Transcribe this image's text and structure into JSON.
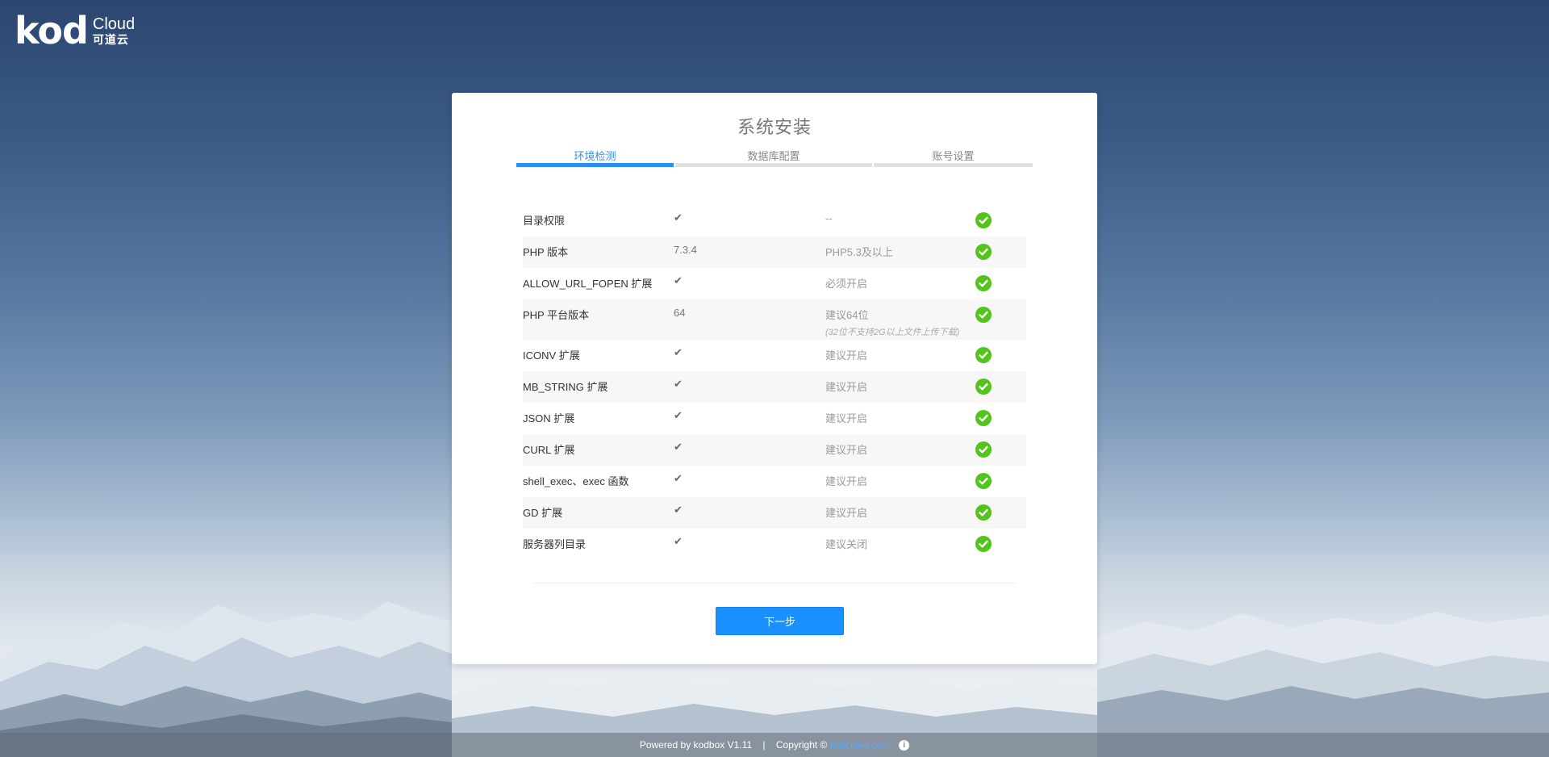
{
  "logo": {
    "main": "kod",
    "sub": "Cloud",
    "cn": "可道云"
  },
  "installer": {
    "title": "系统安装",
    "steps": [
      {
        "label": "环境检测",
        "active": true
      },
      {
        "label": "数据库配置",
        "active": false
      },
      {
        "label": "账号设置",
        "active": false
      }
    ],
    "checks": [
      {
        "name": "目录权限",
        "value": "✔",
        "requirement": "--",
        "note": "",
        "status": "ok"
      },
      {
        "name": "PHP 版本",
        "value": "7.3.4",
        "requirement": "PHP5.3及以上",
        "note": "",
        "status": "ok"
      },
      {
        "name": "ALLOW_URL_FOPEN 扩展",
        "value": "✔",
        "requirement": "必须开启",
        "note": "",
        "status": "ok"
      },
      {
        "name": "PHP 平台版本",
        "value": "64",
        "requirement": "建议64位",
        "note": "(32位不支持2G以上文件上传下载)",
        "status": "ok"
      },
      {
        "name": "ICONV 扩展",
        "value": "✔",
        "requirement": "建议开启",
        "note": "",
        "status": "ok"
      },
      {
        "name": "MB_STRING 扩展",
        "value": "✔",
        "requirement": "建议开启",
        "note": "",
        "status": "ok"
      },
      {
        "name": "JSON 扩展",
        "value": "✔",
        "requirement": "建议开启",
        "note": "",
        "status": "ok"
      },
      {
        "name": "CURL 扩展",
        "value": "✔",
        "requirement": "建议开启",
        "note": "",
        "status": "ok"
      },
      {
        "name": "shell_exec、exec 函数",
        "value": "✔",
        "requirement": "建议开启",
        "note": "",
        "status": "ok"
      },
      {
        "name": "GD 扩展",
        "value": "✔",
        "requirement": "建议开启",
        "note": "",
        "status": "ok"
      },
      {
        "name": "服务器列目录",
        "value": "✔",
        "requirement": "建议关闭",
        "note": "",
        "status": "ok"
      }
    ],
    "next_button": "下一步"
  },
  "footer": {
    "powered": "Powered by kodbox V1.11",
    "separator": "|",
    "copyright": "Copyright ©",
    "link": "kodcloud.com",
    "info_icon": "i"
  },
  "colors": {
    "accent": "#1a90ff",
    "success": "#52c41a"
  }
}
